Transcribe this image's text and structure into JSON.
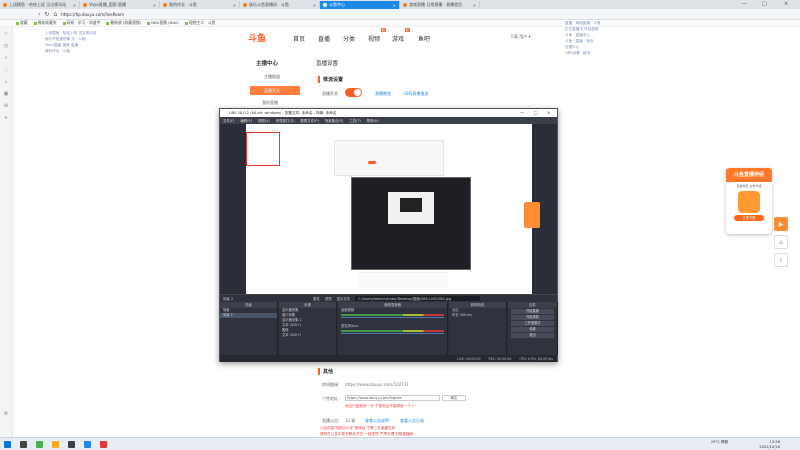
{
  "browser": {
    "tabs": [
      {
        "label": "上班摸鱼 · 哈哈上班 当当视讯站"
      },
      {
        "label": "Vayo直播_国家·直播"
      },
      {
        "label": "我的作业 · 斗鱼"
      },
      {
        "label": "极乐斗鱼直播间 · 斗鱼"
      },
      {
        "label": "斗鱼中心"
      },
      {
        "label": "游戏直播 日常直播 · 直播首页"
      }
    ],
    "active_tab": 4,
    "url": "https://hp.douyu.com/liveRoom",
    "bookmarks": [
      "收藏",
      "微软收藏夹",
      "网易 · 学习 · 知道中",
      "最新收 (收藏视频)",
      "NBA直播 (NBA)",
      "理想主义 · 斗鱼"
    ]
  },
  "left_floating_list": [
    "上班摸鱼 · 哈哈上班 当当视讯站",
    "我们不知道的事 天 · 斗鱼",
    "Vayo直播_国家·直播",
    "我的作业 · 斗鱼"
  ],
  "right_floating_list": [
    "直播 · 网络直播 · 斗鱼",
    "正在直播中 在线视频",
    "斗鱼 · 直播中心",
    "斗鱼 · 直播 · 首页",
    "设置中心",
    "OBS设置 · 推流"
  ],
  "douyu": {
    "logo": "斗鱼",
    "nav": [
      "首页",
      "直播",
      "分类",
      "视频",
      "游戏",
      "鱼吧"
    ],
    "hot_badge": "热",
    "right_text": "下载  用户 ▾",
    "sidebar_title": "主播中心",
    "sidebar_items": [
      "主播权益",
      "直播开关",
      "我的直播"
    ],
    "panel_title": "直播设置",
    "section_title": "推流设置",
    "toggle_label": "直播开关",
    "links": [
      "直播教程",
      "OBS直播推流"
    ],
    "other_title": "其他",
    "room_label": "房间链接：",
    "room_url": "https://www.douyu.com/102731",
    "addr_label": "个性地址：",
    "addr_prefix": "https://www.douyu.com/",
    "addr_value": "fugeee",
    "copy_button": "确定",
    "addr_note": "地址只能修改一次  个性地址不能修改一个人",
    "grade_label": "直播公告：",
    "grade_value": "12 级",
    "grade_links": [
      "查看公告说明",
      "查看公告记录"
    ],
    "red_notes": [
      "公告内容不超过50字 修改后 于第二天凌晨生效",
      "请勿在公告中发布联系方式  一经发现 严肃处理 封禁直播间"
    ]
  },
  "obs": {
    "title": "OBS 28.0.2 (64-bit, windows) - 配置文件: 未命名 - 场景: 未命名",
    "menu": [
      "文件(F)",
      "编辑(E)",
      "视图(V)",
      "停靠窗口(D)",
      "配置文件(P)",
      "场景集合(S)",
      "工具(T)",
      "帮助(H)"
    ],
    "ctrlbar": [
      "场景 2",
      "属性",
      "滤镜",
      "显示文件"
    ],
    "path": "C:/Users/Administrator/Desktop/直播/OBS-LIVE/OBS.jpg",
    "docks": {
      "scenes": {
        "title": "场景",
        "items": [
          "场景",
          "场景 2"
        ]
      },
      "sources": {
        "title": "来源",
        "items": [
          "显示器采集",
          "窗口采集",
          "显示器采集 2",
          "文本 (GDI+)",
          "图像",
          "文本 (GDI+)"
        ]
      },
      "mixer": {
        "title": "音频混音器",
        "items": [
          "桌面音频",
          "麦克风/Aux"
        ]
      },
      "transitions": {
        "title": "转场特效",
        "items": [
          "淡出",
          "时长 300 ms"
        ]
      },
      "controls": {
        "title": "控件",
        "items": [
          "开始直播",
          "开始录制",
          "工作室模式",
          "设置",
          "退出"
        ]
      }
    },
    "status": [
      "LIVE: 00:00:00",
      "REC: 00:00:00",
      "CPU: 0.9%, 60.00 fps"
    ]
  },
  "ad": {
    "title": "斗鱼直播伴侣",
    "text": "直播伴侣 全新升级",
    "button": "立即下载"
  },
  "taskbar": {
    "weather": "25°C 晴朗",
    "time": "13:56",
    "date": "2022/10/16"
  }
}
